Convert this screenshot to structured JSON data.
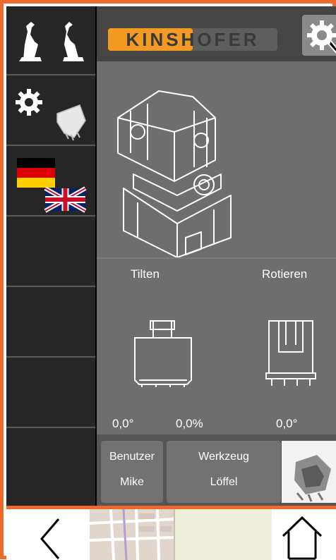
{
  "brand": {
    "logo_text": "KINSHOFER"
  },
  "sidebar": {
    "items": [
      {
        "icon": "joystick-icon"
      },
      {
        "icon": "gear-bucket-icon"
      },
      {
        "icon": "language-flags-icon"
      },
      {
        "icon": "empty"
      },
      {
        "icon": "empty"
      },
      {
        "icon": "empty"
      },
      {
        "icon": "empty"
      }
    ]
  },
  "header": {
    "settings_icon": "gear-icon"
  },
  "main": {
    "tilt_label": "Tilten",
    "rotate_label": "Rotieren",
    "values": {
      "tilt_angle": "0,0°",
      "tilt_percent": "0,0%",
      "rotate_angle": "0,0°"
    }
  },
  "bottom": {
    "user_label": "Benutzer",
    "user_value": "Mike",
    "tool_label": "Werkzeug",
    "tool_value": "Löffel"
  },
  "footer": {
    "back_icon": "chevron-left-icon",
    "home_icon": "home-icon"
  },
  "colors": {
    "border": "#ee6a2b",
    "brand_orange": "#f39a23",
    "panel_dark": "#262626",
    "panel_mid": "#6e6e6e"
  }
}
